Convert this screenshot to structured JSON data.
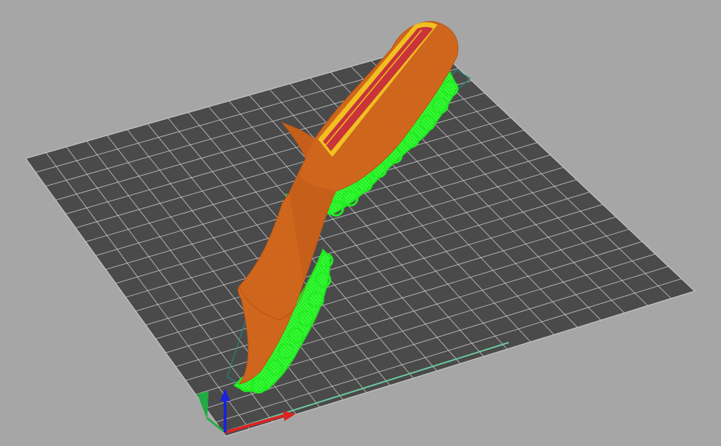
{
  "viewport": {
    "background": "#a6a6a6",
    "bed_color": "#4a4a4a",
    "grid_line_color": "#d0d0d0",
    "model_color": "#d2691e",
    "model_top_fill": "#c8343a",
    "model_top_outline": "#f0c020",
    "support_color": "#33ff33",
    "bounding_box_color": "#1e8a78",
    "axis_colors": {
      "x": "#dd2222",
      "y": "#22aa44",
      "z": "#1a22dd"
    }
  },
  "bed": {
    "grid_divisions": 20
  },
  "icons": {
    "axes": "xyz-axes-icon"
  }
}
